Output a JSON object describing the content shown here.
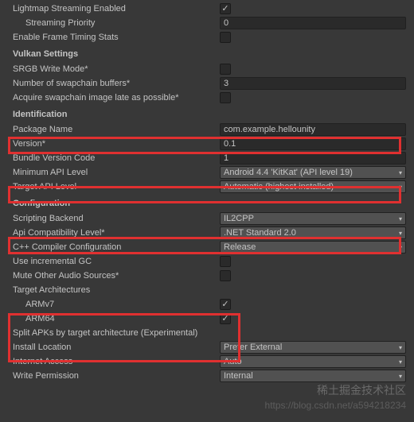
{
  "top": {
    "lightmap_streaming": "Lightmap Streaming Enabled",
    "streaming_priority": "Streaming Priority",
    "streaming_priority_val": "0",
    "enable_frame_timing": "Enable Frame Timing Stats"
  },
  "vulkan": {
    "header": "Vulkan Settings",
    "srgb": "SRGB Write Mode*",
    "swapchain": "Number of swapchain buffers*",
    "swapchain_val": "3",
    "acquire_late": "Acquire swapchain image late as possible*"
  },
  "identification": {
    "header": "Identification",
    "package_name": "Package Name",
    "package_name_val": "com.example.hellounity",
    "version": "Version*",
    "version_val": "0.1",
    "bundle_code": "Bundle Version Code",
    "bundle_code_val": "1",
    "min_api": "Minimum API Level",
    "min_api_val": "Android 4.4 'KitKat' (API level 19)",
    "target_api": "Target API Level",
    "target_api_val": "Automatic (highest installed)"
  },
  "configuration": {
    "header": "Configuration",
    "backend": "Scripting Backend",
    "backend_val": "IL2CPP",
    "api_compat": "Api Compatibility Level*",
    "api_compat_val": ".NET Standard 2.0",
    "cpp_compiler": "C++ Compiler Configuration",
    "cpp_compiler_val": "Release",
    "incremental_gc": "Use incremental GC",
    "mute_audio": "Mute Other Audio Sources*",
    "target_arch": "Target Architectures",
    "armv7": "ARMv7",
    "arm64": "ARM64",
    "split_apks": "Split APKs by target architecture (Experimental)",
    "install_loc": "Install Location",
    "install_loc_val": "Prefer External",
    "internet": "Internet Access",
    "internet_val": "Auto",
    "write_perm": "Write Permission",
    "write_perm_val": "Internal"
  },
  "watermark1": "稀土掘金技术社区",
  "watermark2": "https://blog.csdn.net/a594218234"
}
